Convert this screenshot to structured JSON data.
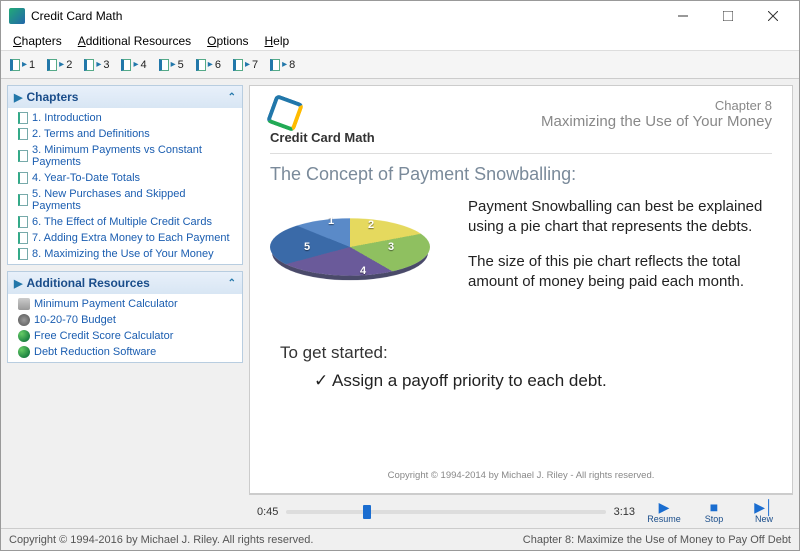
{
  "window": {
    "title": "Credit Card Math"
  },
  "menu": {
    "chapters": "Chapters",
    "resources": "Additional Resources",
    "options": "Options",
    "help": "Help"
  },
  "toolbar": {
    "items": [
      "1",
      "2",
      "3",
      "4",
      "5",
      "6",
      "7",
      "8"
    ]
  },
  "sidebar": {
    "chapters": {
      "title": "Chapters",
      "items": [
        {
          "label": "1.  Introduction"
        },
        {
          "label": "2.  Terms and Definitions"
        },
        {
          "label": "3.  Minimum Payments vs Constant Payments"
        },
        {
          "label": "4.  Year-To-Date Totals"
        },
        {
          "label": "5.  New Purchases and Skipped Payments"
        },
        {
          "label": "6.  The Effect of Multiple Credit Cards"
        },
        {
          "label": "7.  Adding Extra Money to Each Payment"
        },
        {
          "label": "8.  Maximizing the Use of Your Money"
        }
      ]
    },
    "resources": {
      "title": "Additional Resources",
      "items": [
        {
          "label": "Minimum Payment Calculator",
          "icon": "calc"
        },
        {
          "label": "10-20-70 Budget",
          "icon": "disk"
        },
        {
          "label": "Free Credit Score Calculator",
          "icon": "globe"
        },
        {
          "label": "Debt Reduction Software",
          "icon": "globe"
        }
      ]
    }
  },
  "slide": {
    "brand": "Credit Card Math",
    "chapter_num": "Chapter 8",
    "chapter_name": "Maximizing  the Use of Your Money",
    "concept_title": "The Concept of Payment Snowballing:",
    "para1": "Payment Snowballing can best be explained using a pie chart that represents the debts.",
    "para2": "The size of this pie chart reflects the total amount of money being paid each month.",
    "get_started": "To get started:",
    "bullet1": "Assign a payoff priority to each debt.",
    "copyright": "Copyright © 1994-2014  by Michael J. Riley - All rights reserved."
  },
  "player": {
    "current": "0:45",
    "total": "3:13",
    "progress_pct": 24,
    "resume": "Resume",
    "stop": "Stop",
    "new": "New"
  },
  "status": {
    "left": "Copyright © 1994-2016 by Michael J. Riley. All rights reserved.",
    "right": "Chapter 8:  Maximize the Use of Money to Pay Off Debt"
  },
  "chart_data": {
    "type": "pie",
    "title": "Debts",
    "series": [
      {
        "name": "1",
        "value": 20,
        "color": "#5a8ac8"
      },
      {
        "name": "2",
        "value": 20,
        "color": "#e5d95e"
      },
      {
        "name": "3",
        "value": 17,
        "color": "#8fc060"
      },
      {
        "name": "4",
        "value": 27,
        "color": "#6a5a9a"
      },
      {
        "name": "5",
        "value": 16,
        "color": "#3a6aa8"
      }
    ]
  }
}
